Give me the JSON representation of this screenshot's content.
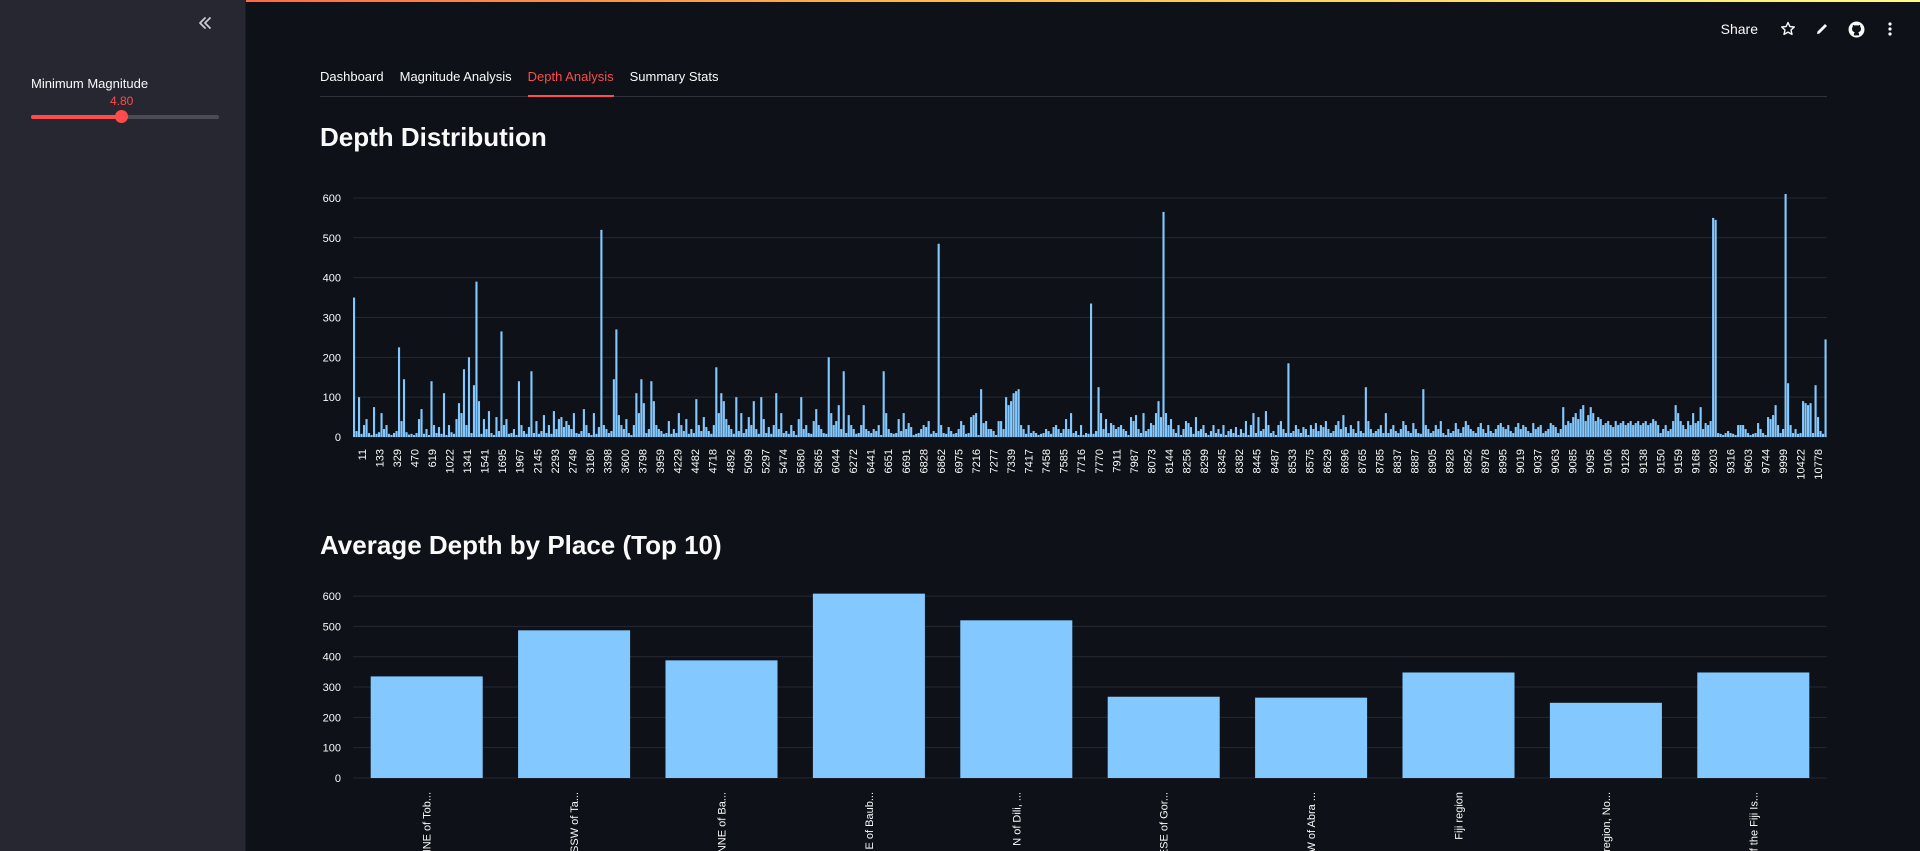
{
  "sidebar": {
    "collapse_icon": "double-chevron-left-icon",
    "slider": {
      "label": "Minimum Magnitude",
      "value": "4.80",
      "fraction": 0.48
    }
  },
  "toolbar": {
    "share_label": "Share",
    "icons": [
      "star-icon",
      "pencil-icon",
      "github-icon",
      "kebab-menu-icon"
    ]
  },
  "tabs": [
    {
      "label": "Dashboard",
      "active": false
    },
    {
      "label": "Magnitude Analysis",
      "active": false
    },
    {
      "label": "Depth Analysis",
      "active": true
    },
    {
      "label": "Summary Stats",
      "active": false
    }
  ],
  "colors": {
    "accent": "#ff4b4b",
    "bar": "#83c9ff",
    "background": "#0e1117",
    "sidebar": "#262730"
  },
  "headings": {
    "depth": "Depth Distribution",
    "place": "Average Depth by Place (Top 10)"
  },
  "chart_data": [
    {
      "type": "bar",
      "title": "Depth Distribution",
      "xlabel": "",
      "ylabel": "",
      "ylim": [
        0,
        620
      ],
      "yticks": [
        0,
        100,
        200,
        300,
        400,
        500,
        600
      ],
      "grid": true,
      "x_tick_labels": [
        "11",
        "133",
        "329",
        "470",
        "619",
        "1022",
        "1341",
        "1541",
        "1695",
        "1967",
        "2145",
        "2293",
        "2749",
        "3180",
        "3398",
        "3600",
        "3798",
        "3959",
        "4229",
        "4482",
        "4718",
        "4892",
        "5099",
        "5297",
        "5474",
        "5680",
        "5865",
        "6044",
        "6272",
        "6441",
        "6651",
        "6691",
        "6828",
        "6862",
        "6975",
        "7216",
        "7277",
        "7339",
        "7417",
        "7458",
        "7585",
        "7716",
        "7770",
        "7911",
        "7987",
        "8073",
        "8144",
        "8256",
        "8299",
        "8345",
        "8382",
        "8445",
        "8487",
        "8533",
        "8575",
        "8629",
        "8696",
        "8765",
        "8785",
        "8837",
        "8887",
        "8905",
        "8928",
        "8952",
        "8978",
        "8995",
        "9019",
        "9037",
        "9063",
        "9085",
        "9095",
        "9106",
        "9128",
        "9138",
        "9150",
        "9159",
        "9168",
        "9203",
        "9316",
        "9603",
        "9744",
        "9999",
        "10422",
        "10778"
      ],
      "values": [
        350,
        15,
        100,
        8,
        30,
        45,
        10,
        5,
        75,
        8,
        12,
        60,
        20,
        30,
        8,
        5,
        10,
        15,
        225,
        40,
        145,
        12,
        6,
        8,
        5,
        10,
        45,
        70,
        8,
        20,
        5,
        140,
        30,
        10,
        25,
        8,
        110,
        5,
        30,
        12,
        8,
        45,
        85,
        60,
        170,
        30,
        200,
        10,
        130,
        390,
        90,
        8,
        45,
        20,
        65,
        10,
        5,
        50,
        15,
        265,
        30,
        45,
        8,
        10,
        20,
        5,
        140,
        30,
        15,
        8,
        25,
        165,
        10,
        40,
        8,
        15,
        55,
        10,
        30,
        8,
        65,
        20,
        45,
        50,
        25,
        40,
        30,
        20,
        60,
        10,
        8,
        15,
        70,
        30,
        10,
        5,
        60,
        8,
        25,
        520,
        30,
        20,
        10,
        15,
        145,
        270,
        55,
        30,
        20,
        45,
        10,
        5,
        30,
        110,
        60,
        145,
        85,
        10,
        20,
        140,
        90,
        30,
        20,
        15,
        8,
        10,
        40,
        8,
        20,
        10,
        60,
        30,
        15,
        45,
        8,
        20,
        10,
        95,
        30,
        15,
        50,
        25,
        15,
        8,
        30,
        175,
        60,
        110,
        90,
        45,
        30,
        20,
        8,
        100,
        15,
        60,
        10,
        20,
        50,
        30,
        90,
        20,
        8,
        100,
        45,
        10,
        25,
        8,
        30,
        110,
        20,
        60,
        10,
        15,
        8,
        30,
        15,
        5,
        45,
        100,
        20,
        30,
        10,
        8,
        40,
        70,
        30,
        20,
        10,
        8,
        200,
        60,
        30,
        40,
        80,
        20,
        165,
        10,
        55,
        30,
        20,
        8,
        10,
        30,
        80,
        20,
        15,
        10,
        20,
        15,
        30,
        5,
        165,
        60,
        20,
        10,
        8,
        10,
        45,
        15,
        60,
        20,
        35,
        25,
        5,
        8,
        10,
        20,
        30,
        25,
        40,
        8,
        15,
        10,
        485,
        30,
        10,
        8,
        25,
        15,
        8,
        10,
        20,
        40,
        30,
        8,
        10,
        50,
        55,
        60,
        5,
        120,
        35,
        40,
        20,
        20,
        15,
        5,
        40,
        40,
        20,
        100,
        80,
        90,
        110,
        115,
        120,
        30,
        20,
        8,
        30,
        10,
        15,
        10,
        5,
        8,
        10,
        20,
        15,
        8,
        25,
        30,
        20,
        10,
        20,
        45,
        20,
        60,
        10,
        15,
        5,
        30,
        5,
        10,
        8,
        335,
        8,
        15,
        125,
        60,
        20,
        45,
        10,
        35,
        30,
        20,
        25,
        30,
        20,
        15,
        5,
        50,
        40,
        55,
        20,
        10,
        60,
        15,
        20,
        35,
        30,
        60,
        90,
        50,
        565,
        60,
        30,
        45,
        20,
        10,
        30,
        5,
        20,
        40,
        35,
        25,
        8,
        50,
        15,
        20,
        30,
        10,
        5,
        15,
        30,
        10,
        20,
        8,
        30,
        5,
        15,
        20,
        10,
        25,
        5,
        20,
        10,
        40,
        5,
        30,
        60,
        10,
        50,
        15,
        20,
        65,
        30,
        10,
        15,
        5,
        30,
        40,
        20,
        10,
        185,
        10,
        15,
        30,
        20,
        10,
        25,
        20,
        5,
        30,
        20,
        35,
        15,
        30,
        25,
        40,
        20,
        10,
        15,
        30,
        40,
        20,
        55,
        25,
        10,
        30,
        20,
        10,
        40,
        15,
        10,
        125,
        40,
        20,
        10,
        15,
        20,
        30,
        10,
        60,
        10,
        20,
        30,
        15,
        10,
        20,
        40,
        30,
        15,
        10,
        35,
        20,
        10,
        8,
        120,
        30,
        20,
        10,
        15,
        30,
        20,
        40,
        10,
        5,
        20,
        10,
        15,
        35,
        20,
        10,
        25,
        40,
        30,
        20,
        15,
        10,
        25,
        35,
        20,
        10,
        30,
        15,
        10,
        20,
        30,
        35,
        25,
        20,
        30,
        15,
        10,
        25,
        35,
        20,
        30,
        25,
        15,
        10,
        35,
        20,
        25,
        30,
        10,
        15,
        20,
        35,
        30,
        25,
        10,
        20,
        75,
        30,
        40,
        35,
        50,
        60,
        45,
        70,
        80,
        40,
        55,
        75,
        60,
        40,
        50,
        45,
        30,
        35,
        40,
        30,
        25,
        40,
        30,
        35,
        40,
        30,
        35,
        40,
        30,
        35,
        40,
        30,
        35,
        40,
        30,
        35,
        45,
        40,
        30,
        10,
        20,
        30,
        15,
        20,
        40,
        80,
        60,
        40,
        30,
        20,
        40,
        30,
        60,
        35,
        40,
        75,
        20,
        35,
        30,
        40,
        550,
        545,
        10,
        8,
        5,
        10,
        15,
        10,
        8,
        5,
        30,
        30,
        30,
        20,
        10,
        5,
        8,
        10,
        35,
        20,
        10,
        5,
        50,
        45,
        55,
        80,
        30,
        10,
        20,
        610,
        135,
        30,
        10,
        20,
        8,
        10,
        90,
        85,
        80,
        85,
        10,
        130,
        50,
        15,
        8,
        245
      ]
    },
    {
      "type": "bar",
      "title": "Average Depth by Place (Top 10)",
      "xlabel": "",
      "ylabel": "",
      "ylim": [
        0,
        620
      ],
      "yticks": [
        0,
        100,
        200,
        300,
        400,
        500,
        600
      ],
      "grid": true,
      "categories": [
        "NNE of Tob...",
        "SSW of Ta...",
        "NNE of Ba...",
        "E of Baub...",
        "N of Dili, ...",
        "ESE of Gor...",
        "W of Abra ...",
        "Fiji region",
        "region, No...",
        "of the Fiji Is..."
      ],
      "values": [
        335,
        487,
        388,
        608,
        520,
        268,
        265,
        348,
        248,
        348
      ]
    }
  ]
}
